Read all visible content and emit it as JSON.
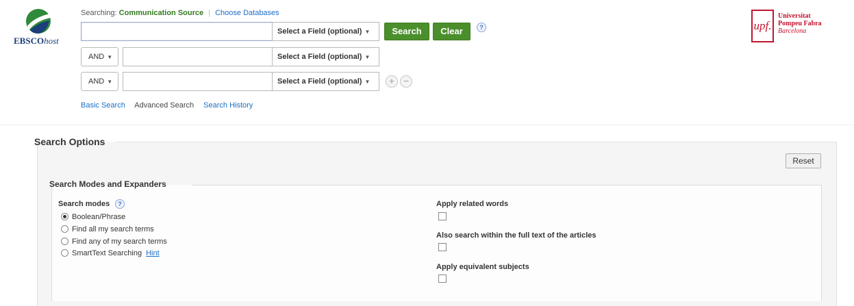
{
  "header": {
    "logo_text": "EBSCO",
    "logo_text_host": "host",
    "searching_label": "Searching:",
    "database_name": "Communication Source",
    "choose_databases": "Choose Databases"
  },
  "search_rows": [
    {
      "boolean": "",
      "term": "",
      "field": "Select a Field (optional)"
    },
    {
      "boolean": "AND",
      "term": "",
      "field": "Select a Field (optional)"
    },
    {
      "boolean": "AND",
      "term": "",
      "field": "Select a Field (optional)"
    }
  ],
  "buttons": {
    "search": "Search",
    "clear": "Clear",
    "help": "?",
    "add_row": "+",
    "remove_row": "−"
  },
  "search_links": {
    "basic": "Basic Search",
    "advanced": "Advanced Search",
    "history": "Search History"
  },
  "institution": {
    "mark": "upf.",
    "line1": "Universitat",
    "line2": "Pompeu Fabra",
    "line3": "Barcelona"
  },
  "search_options": {
    "title": "Search Options",
    "reset": "Reset",
    "modes_section_title": "Search Modes and Expanders",
    "modes_label": "Search modes",
    "modes_help": "?",
    "modes": [
      {
        "label": "Boolean/Phrase",
        "selected": true
      },
      {
        "label": "Find all my search terms",
        "selected": false
      },
      {
        "label": "Find any of my search terms",
        "selected": false
      },
      {
        "label": "SmartText Searching",
        "selected": false
      }
    ],
    "hint": "Hint",
    "expanders": [
      {
        "label": "Apply related words",
        "checked": false
      },
      {
        "label": "Also search within the full text of the articles",
        "checked": false
      },
      {
        "label": "Apply equivalent subjects",
        "checked": false
      }
    ]
  },
  "colors": {
    "green_button": "#4b8f2c",
    "link": "#1a6fc4",
    "brand_red": "#c3132e",
    "ebsco_blue": "#1b3f78"
  }
}
